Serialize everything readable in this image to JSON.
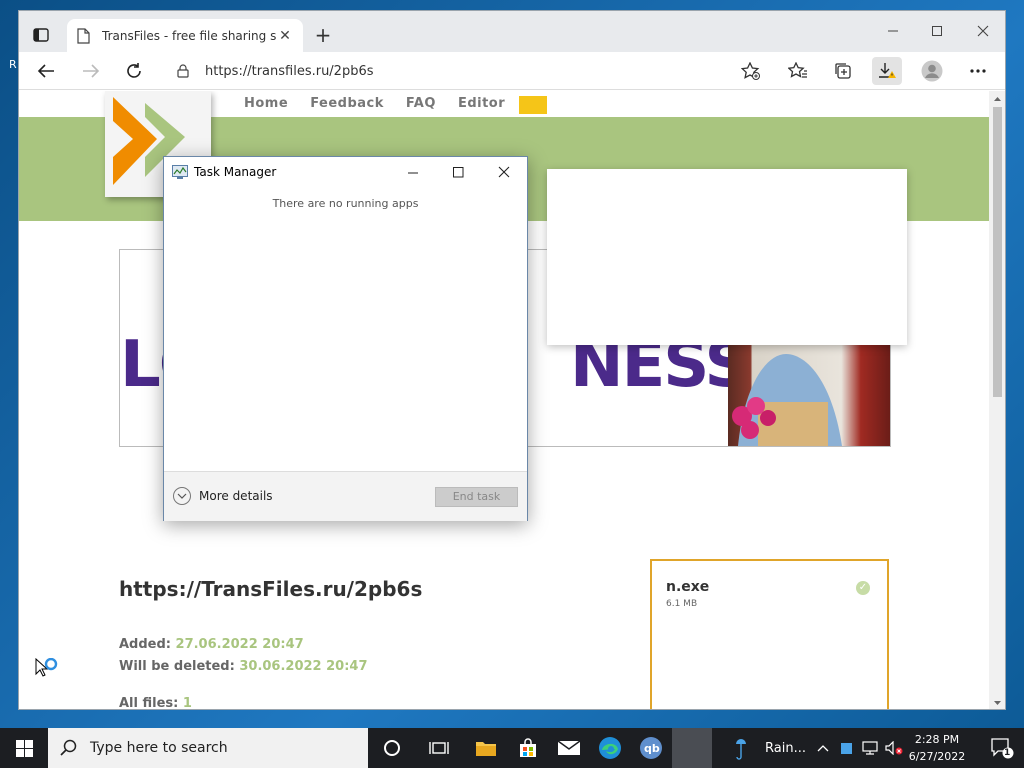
{
  "desktop": {
    "edge_char": "R"
  },
  "browser": {
    "tab": {
      "title": "TransFiles - free file sharing serv",
      "close_glyph": "✕"
    },
    "new_tab_glyph": "+",
    "address": {
      "url": "https://transfiles.ru/2pb6s"
    }
  },
  "page": {
    "nav": [
      "Home",
      "Feedback",
      "FAQ",
      "Editor"
    ],
    "banner": {
      "left": "LC",
      "right": "NESS"
    },
    "file_url": "https://TransFiles.ru/2pb6s",
    "added_label": "Added:",
    "added_value": "27.06.2022 20:47",
    "deleted_label": "Will be deleted:",
    "deleted_value": "30.06.2022 20:47",
    "allfiles_label": "All files:",
    "allfiles_value": "1",
    "file_card": {
      "name": "n.exe",
      "size": "6.1 MB",
      "check": "✓"
    },
    "colors": {
      "green": "#a9c57f",
      "orange": "#e0a52a",
      "purple": "#4b2a8a"
    }
  },
  "task_manager": {
    "title": "Task Manager",
    "empty_message": "There are no running apps",
    "more_details": "More details",
    "end_task": "End task"
  },
  "taskbar": {
    "search_placeholder": "Type here to search",
    "weather": "Rain...",
    "time": "2:28 PM",
    "date": "6/27/2022",
    "notification_count": "1"
  }
}
